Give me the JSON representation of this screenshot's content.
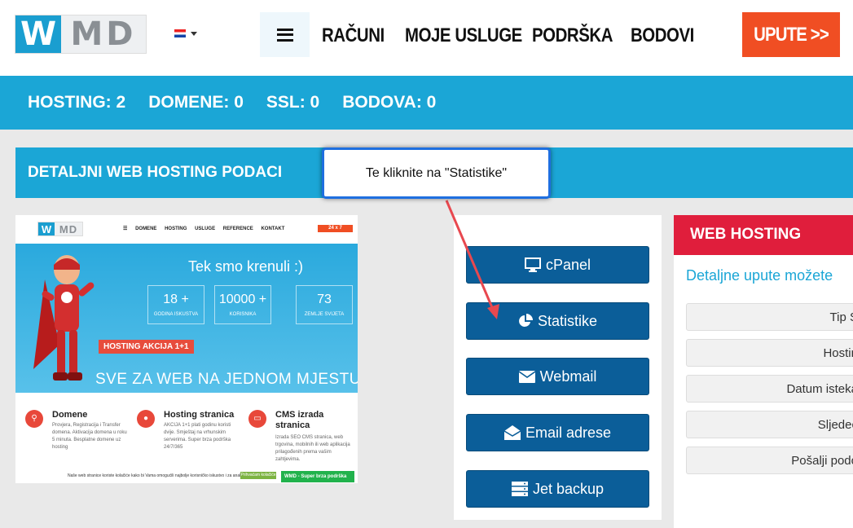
{
  "logo": {
    "w": "W",
    "md": "MD"
  },
  "nav": {
    "items": [
      "RAČUNI",
      "MOJE USLUGE",
      "PODRŠKA",
      "BODOVI"
    ],
    "cta": "UPUTE >>"
  },
  "stats": [
    "HOSTING: 2",
    "DOMENE: 0",
    "SSL: 0",
    "BODOVA: 0"
  ],
  "details_title": "DETALJNI WEB HOSTING PODACI",
  "tooltip": "Te kliknite na \"Statistike\"",
  "preview": {
    "logo_w": "W",
    "logo_md": "MD",
    "menu": [
      "DOMENE",
      "HOSTING",
      "USLUGE",
      "REFERENCE",
      "KONTAKT"
    ],
    "badge": "24 x 7",
    "hero_title": "Tek smo krenuli :)",
    "boxes": [
      {
        "n": "18 +",
        "l": "GODINA ISKUSTVA"
      },
      {
        "n": "10000 +",
        "l": "KORISNIKA"
      },
      {
        "n": "73",
        "l": "ZEMLJE SVIJETA"
      }
    ],
    "action": "HOSTING AKCIJA 1+1",
    "slogan": "SVE ZA WEB NA JEDNOM MJESTU",
    "features": [
      {
        "t": "Domene",
        "d": "Provjera, Registracija i Transfer domena. Aktivacija domena u roku 5 minuta. Besplatne domene uz hosting"
      },
      {
        "t": "Hosting stranica",
        "d": "AKCIJA 1+1 plati godinu koristi dvije. Smještaj na vrhunskim serverima. Super brza podrška 24/7/365"
      },
      {
        "t": "CMS izrada stranica",
        "d": "Izrada SEO CMS stranica, web trgovina, mobilnih ili web aplikacija prilagođenih prema vašim zahtjevima."
      }
    ],
    "cookie": "Naše web stranice koriste kolačiće kako bi Vama omogućili najbolje korisničko iskustvo i za analizu prometa.",
    "cookie_ok": "Prihvaćam kolačiće",
    "chat": "WMD - Super brza podrška"
  },
  "buttons": [
    "cPanel",
    "Statistike",
    "Webmail",
    "Email adrese",
    "Jet backup"
  ],
  "web_hosting": {
    "title": "WEB HOSTING",
    "link": "Detaljne upute možete",
    "rows": [
      "Tip S",
      "Hostin",
      "Datum isteka",
      "Sljedeć",
      "Pošalji podo"
    ]
  },
  "colors": {
    "primary": "#1ba6d6",
    "accent": "#f04e23",
    "button": "#0b5e99",
    "red": "#e01e3c"
  }
}
